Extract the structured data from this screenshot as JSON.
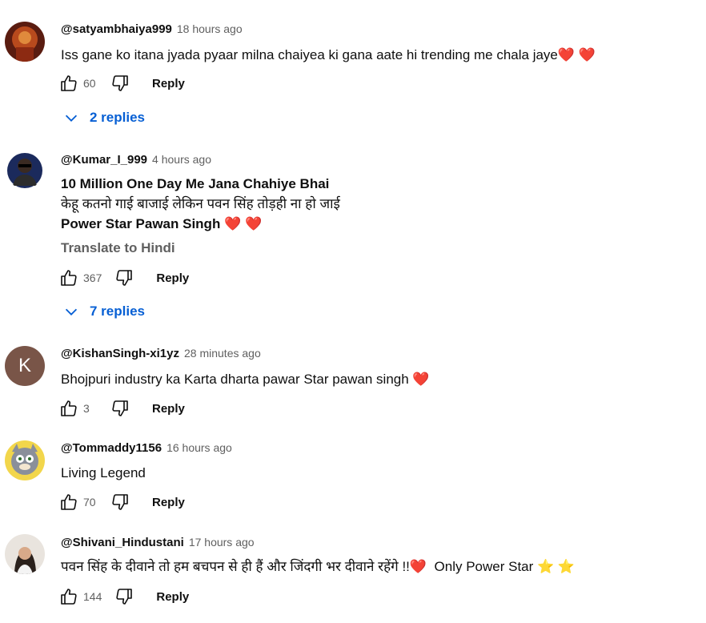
{
  "colors": {
    "link": "#065fd4",
    "muted": "#606060",
    "heart": "#e0242a",
    "star": "#f5c518"
  },
  "comments": [
    {
      "handle": "@satyambhaiya999",
      "time": "18 hours ago",
      "lines": [
        {
          "text": "Iss gane ko itana jyada pyaar milna chaiyea ki gana aate hi trending me chala jaye",
          "hearts": "❤️ ❤️"
        }
      ],
      "likes": "60",
      "reply_label": "Reply",
      "replies": "2 replies"
    },
    {
      "handle": "@Kumar_I_999",
      "time": "4 hours ago",
      "lines": [
        {
          "text": "10 Million One Day Me Jana Chahiye Bhai"
        },
        {
          "text": "केहू कतनो गाई बाजाई लेकिन पवन सिंह तोड़ही ना हो जाई"
        },
        {
          "text": "Power Star Pawan Singh",
          "hearts": "❤️ ❤️"
        }
      ],
      "translate": "Translate to Hindi",
      "likes": "367",
      "reply_label": "Reply",
      "replies": "7 replies"
    },
    {
      "handle": "@KishanSingh-xi1yz",
      "time": "28 minutes ago",
      "avatar_letter": "K",
      "lines": [
        {
          "text": "Bhojpuri industry ka Karta dharta pawar Star pawan singh",
          "hearts": "❤️"
        }
      ],
      "likes": "3",
      "reply_label": "Reply"
    },
    {
      "handle": "@Tommaddy1156",
      "time": "16 hours ago",
      "lines": [
        {
          "text": "Living Legend"
        }
      ],
      "likes": "70",
      "reply_label": "Reply"
    },
    {
      "handle": "@Shivani_Hindustani",
      "time": "17 hours ago",
      "lines": [
        {
          "text": "पवन सिंह के दीवाने तो हम बचपन से ही हैं और जिंदगी भर दीवाने रहेंगे !!",
          "hearts": "❤️",
          "after": "Only Power Star",
          "stars": "⭐ ⭐"
        }
      ],
      "likes": "144",
      "reply_label": "Reply"
    }
  ]
}
